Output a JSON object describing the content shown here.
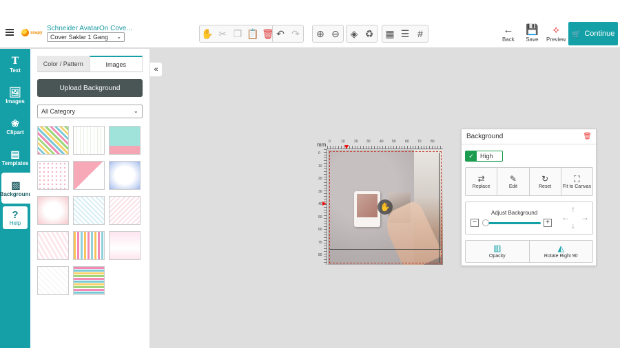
{
  "header": {
    "logo_text": "snapy",
    "product_title": "Schneider AvatarOn Cove...",
    "product_select": "Cover Saklar 1 Gang",
    "back_label": "Back",
    "save_label": "Save",
    "preview_label": "Preview",
    "continue_label": "Continue"
  },
  "toolbar": {
    "group1": [
      "hand-icon",
      "cut-icon",
      "copy-icon",
      "paste-icon",
      "delete-icon"
    ],
    "group2": [
      "undo-icon",
      "redo-icon"
    ],
    "group3": [
      "zoom-in-icon",
      "zoom-out-icon"
    ],
    "group4": [
      "layers-icon",
      "recycle-icon"
    ],
    "group5": [
      "grid-icon",
      "align-icon",
      "guides-icon"
    ]
  },
  "rail": {
    "items": [
      {
        "label": "Text",
        "icon": "text-icon"
      },
      {
        "label": "Images",
        "icon": "image-icon"
      },
      {
        "label": "Clipart",
        "icon": "clipart-icon"
      },
      {
        "label": "Templates",
        "icon": "templates-icon"
      },
      {
        "label": "Background",
        "icon": "background-icon"
      }
    ],
    "help_label": "Help"
  },
  "panel": {
    "tabs": [
      "Color / Pattern",
      "Images"
    ],
    "active_tab": "Images",
    "upload_label": "Upload Background",
    "category_select": "All Category"
  },
  "canvas": {
    "unit_label": "mm",
    "h_ticks": [
      "0",
      "10",
      "20",
      "30",
      "40",
      "50",
      "60",
      "70",
      "80",
      "90"
    ],
    "v_ticks": [
      "0",
      "10",
      "20",
      "30",
      "40",
      "50",
      "60",
      "70",
      "80"
    ]
  },
  "bg_panel": {
    "title": "Background",
    "quality_label": "High",
    "actions": [
      "Replace",
      "Edit",
      "Reset",
      "Fit to Canvas"
    ],
    "adjust_label": "Adjust Background",
    "opacity_label": "Opacity",
    "rotate_label": "Rotate Right 90"
  },
  "colors": {
    "accent": "#13a0a7",
    "dark_button": "#4a5656",
    "quality_green": "#1c9c4e",
    "danger": "#e11111"
  }
}
